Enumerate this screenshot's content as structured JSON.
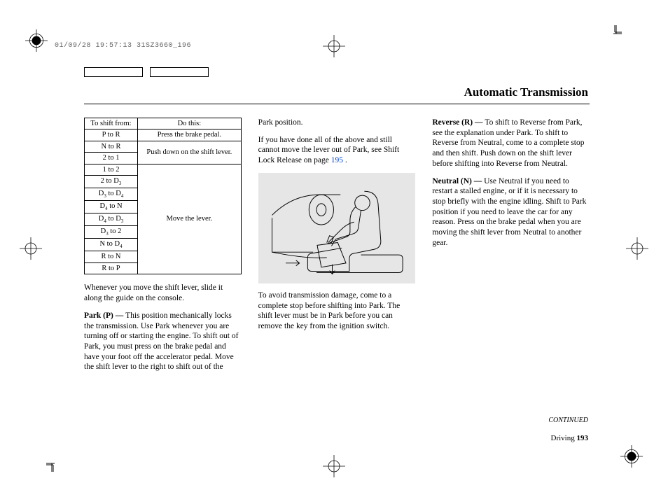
{
  "header_code": "01/09/28 19:57:13 31SZ3660_196",
  "title": "Automatic Transmission",
  "table": {
    "head_left": "To shift from:",
    "head_right": "Do this:",
    "rows": [
      [
        "P to R",
        "Press the brake pedal."
      ],
      [
        "N to R",
        "Push down on the shift lever."
      ],
      [
        "2 to 1",
        ""
      ],
      [
        "1 to 2",
        "Move the lever."
      ],
      [
        "2 to D3",
        ""
      ],
      [
        "D3 to D4",
        ""
      ],
      [
        "D4 to N",
        ""
      ],
      [
        "D4 to D3",
        ""
      ],
      [
        "D3 to 2",
        ""
      ],
      [
        "N to D4",
        ""
      ],
      [
        "R to N",
        ""
      ],
      [
        "R to P",
        ""
      ]
    ]
  },
  "col1": {
    "p1": "Whenever you move the shift lever, slide it along the guide on the console.",
    "p2_label": "Park (P) — ",
    "p2_body": "This position mechani­cally locks the transmission. Use Park whenever you are turning off or starting the engine. To shift out of Park, you must press on the brake pedal and have your foot off the accelerator pedal. Move the shift lever to the right to shift out of the"
  },
  "col2": {
    "p1": "Park position.",
    "p2_a": "If you have done all of the above and still cannot move the lever out of Park, see Shift Lock Release on page ",
    "p2_link": "195",
    "p2_b": " .",
    "p3": "To avoid transmission damage, come to a complete stop before shifting into Park. The shift lever must be in Park before you can remove the key from the ignition switch."
  },
  "col3": {
    "p1_label": "Reverse (R) — ",
    "p1_body": "To shift to Reverse from Park, see the explanation under Park. To shift to Reverse from Neutral, come to a complete stop and then shift. Push down on the shift lever before shifting into Reverse from Neutral.",
    "p2_label": "Neutral (N) — ",
    "p2_body": "Use Neutral if you need to restart a stalled engine, or if it is necessary to stop briefly with the engine idling. Shift to Park posi­tion if you need to leave the car for any reason. Press on the brake pedal when you are moving the shift lever from Neutral to another gear."
  },
  "continued": "CONTINUED",
  "pagenum_section": "Driving",
  "pagenum_num": "193"
}
